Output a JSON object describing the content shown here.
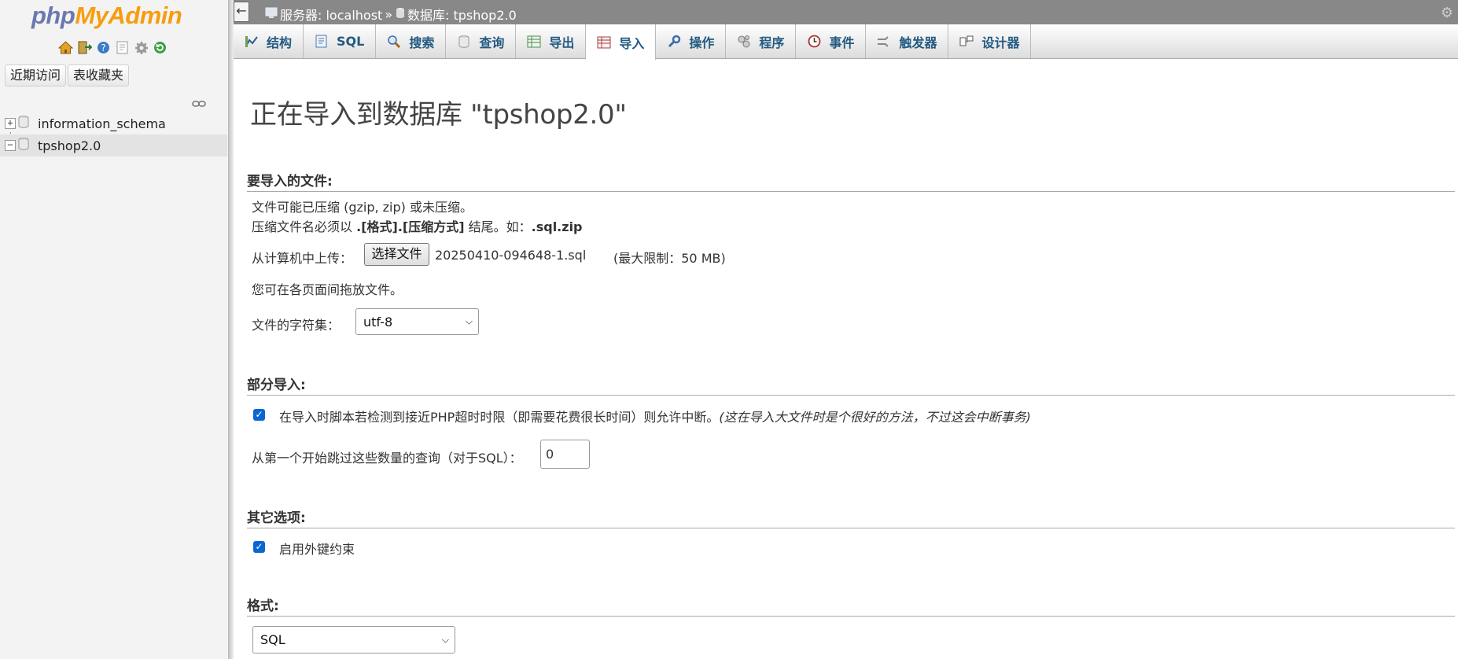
{
  "sidebar": {
    "logo_php": "php",
    "logo_myadmin": "MyAdmin",
    "recent_button": "近期访问",
    "favorites_button": "表收藏夹",
    "databases": [
      {
        "name": "information_schema",
        "expander": "+",
        "selected": false
      },
      {
        "name": "tpshop2.0",
        "expander": "−",
        "selected": true
      }
    ]
  },
  "breadcrumb": {
    "server_label": "服务器: localhost",
    "separator": "»",
    "database_label": "数据库: tpshop2.0"
  },
  "tabs": [
    {
      "label": "结构",
      "icon": "structure-icon"
    },
    {
      "label": "SQL",
      "icon": "sql-icon"
    },
    {
      "label": "搜索",
      "icon": "search-icon"
    },
    {
      "label": "查询",
      "icon": "query-icon"
    },
    {
      "label": "导出",
      "icon": "export-icon"
    },
    {
      "label": "导入",
      "icon": "import-icon",
      "active": true
    },
    {
      "label": "操作",
      "icon": "wrench-icon"
    },
    {
      "label": "程序",
      "icon": "routines-icon"
    },
    {
      "label": "事件",
      "icon": "clock-icon"
    },
    {
      "label": "触发器",
      "icon": "triggers-icon"
    },
    {
      "label": "设计器",
      "icon": "designer-icon"
    }
  ],
  "main": {
    "title": "正在导入到数据库 \"tpshop2.0\"",
    "file_section": {
      "heading": "要导入的文件:",
      "line1": "文件可能已压缩 (gzip, zip) 或未压缩。",
      "line2_prefix": "压缩文件名必须以",
      "line2_bold": ".[格式].[压缩方式]",
      "line2_mid": "结尾。如：",
      "line2_example": ".sql.zip",
      "upload_label": "从计算机中上传：",
      "choose_button": "选择文件",
      "chosen_file": "20250410-094648-1.sql",
      "max_limit": "(最大限制：50 MB)",
      "drag_hint": "您可在各页面间拖放文件。",
      "charset_label": "文件的字符集：",
      "charset_value": "utf-8"
    },
    "partial_section": {
      "heading": "部分导入:",
      "interrupt_label": "在导入时脚本若检测到接近PHP超时时限（即需要花费很长时间）则允许中断。",
      "interrupt_note": "(这在导入大文件时是个很好的方法，不过这会中断事务)",
      "interrupt_checked": true,
      "skip_label": "从第一个开始跳过这些数量的查询（对于SQL）：",
      "skip_value": "0"
    },
    "other_section": {
      "heading": "其它选项:",
      "fk_label": "启用外键约束",
      "fk_checked": true
    },
    "format_section": {
      "heading": "格式:",
      "format_value": "SQL"
    }
  },
  "colors": {
    "tab_text": "#235a81",
    "logo_php": "#6c78af",
    "logo_myadmin": "#f89c0e",
    "checkbox": "#0a66d4"
  }
}
